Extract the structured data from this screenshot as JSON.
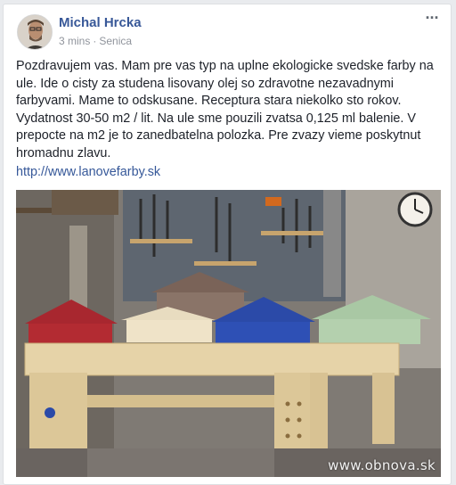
{
  "post": {
    "author": "Michal Hrcka",
    "time": "3 mins",
    "location": "Senica",
    "separator": "·",
    "more_label": "···",
    "text": "Pozdravujem vas. Mam pre vas typ na uplne ekologicke svedske farby na ule. Ide o cisty za studena lisovany olej so zdravotne nezavadnymi farbyvami. Mame to odskusane. Receptura stara niekolko sto rokov. Vydatnost 30-50 m2 / lit. Na ule sme pouzili zvatsa 0,125 ml balenie. V prepocte na m2 je to zanedbatelna polozka. Pre zvazy vieme poskytnut hromadnu zlavu.",
    "link": "http://www.lanovefarby.sk",
    "photo": {
      "watermark": "www.obnova.sk"
    }
  },
  "colors": {
    "author_link": "#385898",
    "meta_gray": "#90949c",
    "body_text": "#1d2129",
    "link": "#365899"
  }
}
